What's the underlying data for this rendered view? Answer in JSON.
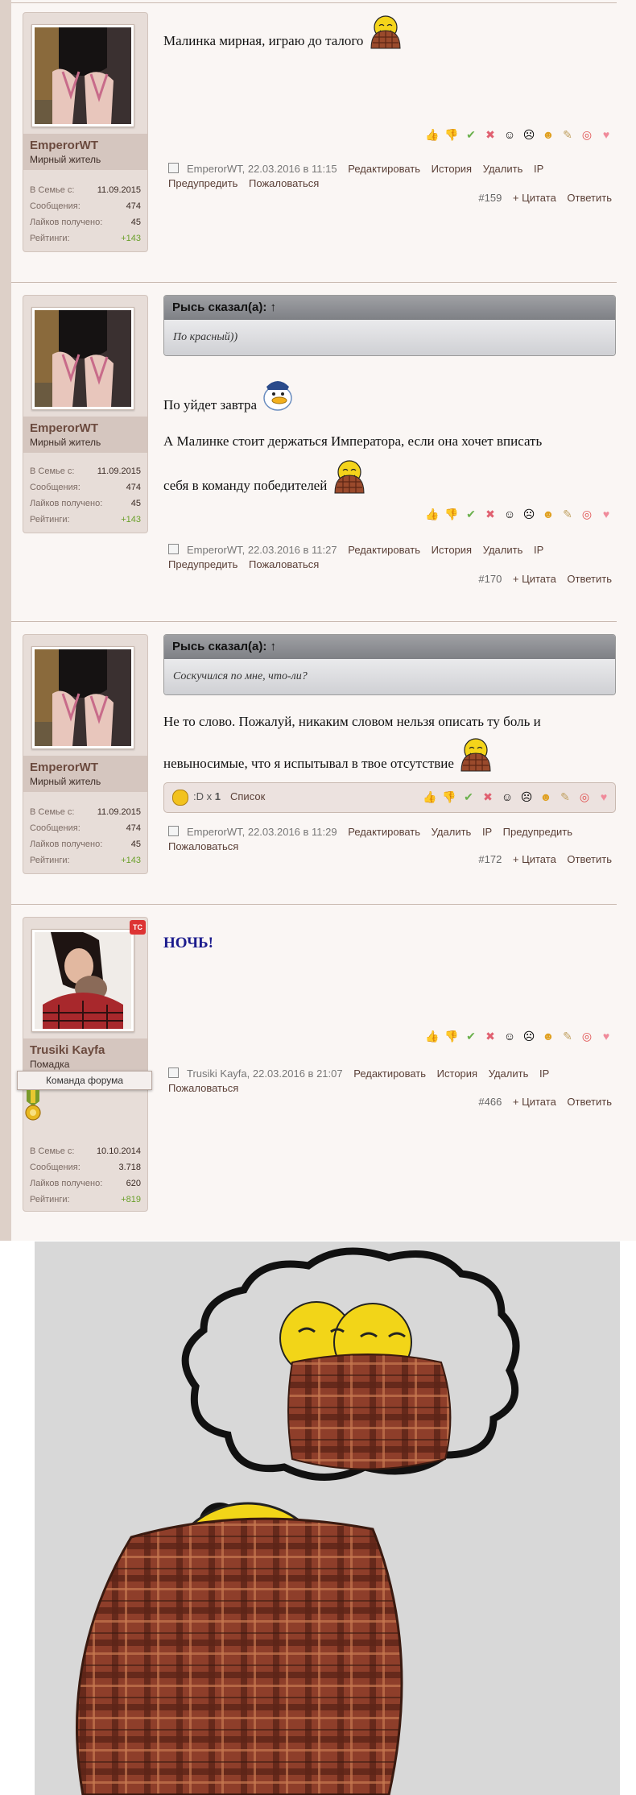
{
  "posts": [
    {
      "username": "EmperorWT",
      "user_title": "Мирный житель",
      "stats": {
        "joined_label": "В Семье с:",
        "joined": "11.09.2015",
        "messages_label": "Сообщения:",
        "messages": "474",
        "likes_label": "Лайков получено:",
        "likes": "45",
        "rating_label": "Рейтинги:",
        "rating": "+143"
      },
      "text": "Малинка мирная, играю до талого",
      "author_date": "EmperorWT, 22.03.2016 в 11:15",
      "actions": [
        "Редактировать",
        "История",
        "Удалить",
        "IP"
      ],
      "actions2": [
        "Предупредить",
        "Пожаловаться"
      ],
      "number": "#159",
      "quote_label": "+ Цитата",
      "reply_label": "Ответить"
    },
    {
      "username": "EmperorWT",
      "user_title": "Мирный житель",
      "stats": {
        "joined_label": "В Семье с:",
        "joined": "11.09.2015",
        "messages_label": "Сообщения:",
        "messages": "474",
        "likes_label": "Лайков получено:",
        "likes": "45",
        "rating_label": "Рейтинги:",
        "rating": "+143"
      },
      "quote_author": "Рысь сказал(а): ↑",
      "quote_text": "По красный))",
      "text1": "По уйдет завтра",
      "text2": "А Малинке стоит держаться Императора, если она хочет вписать",
      "text3": "себя в команду победителей",
      "author_date": "EmperorWT, 22.03.2016 в 11:27",
      "actions": [
        "Редактировать",
        "История",
        "Удалить",
        "IP"
      ],
      "actions2": [
        "Предупредить",
        "Пожаловаться"
      ],
      "number": "#170",
      "quote_label": "+ Цитата",
      "reply_label": "Ответить"
    },
    {
      "username": "EmperorWT",
      "user_title": "Мирный житель",
      "stats": {
        "joined_label": "В Семье с:",
        "joined": "11.09.2015",
        "messages_label": "Сообщения:",
        "messages": "474",
        "likes_label": "Лайков получено:",
        "likes": "45",
        "rating_label": "Рейтинги:",
        "rating": "+143"
      },
      "quote_author": "Рысь сказал(а): ↑",
      "quote_text": "Соскучился по мне, что-ли?",
      "text1": "Не то слово. Пожалуй, никаким словом нельзя описать ту боль и",
      "text2": "невыносимые, что я испытывал в твое отсутствие",
      "rating_summary": ":D x",
      "rating_count": "1",
      "rating_list": "Список",
      "author_date": "EmperorWT, 22.03.2016 в 11:29",
      "actions": [
        "Редактировать",
        "Удалить",
        "IP",
        "Предупредить"
      ],
      "actions2": [
        "Пожаловаться"
      ],
      "number": "#172",
      "quote_label": "+ Цитата",
      "reply_label": "Ответить"
    },
    {
      "username": "Trusiki Kayfa",
      "user_title": "Помадка",
      "team_label": "Команда форума",
      "tc_badge": "TC",
      "stats": {
        "joined_label": "В Семье с:",
        "joined": "10.10.2014",
        "messages_label": "Сообщения:",
        "messages": "3.718",
        "likes_label": "Лайков получено:",
        "likes": "620",
        "rating_label": "Рейтинги:",
        "rating": "+819"
      },
      "text": "НОЧЬ!",
      "author_date": "Trusiki Kayfa, 22.03.2016 в 21:07",
      "actions": [
        "Редактировать",
        "История",
        "Удалить",
        "IP"
      ],
      "actions2": [
        "Пожаловаться"
      ],
      "number": "#466",
      "quote_label": "+ Цитата",
      "reply_label": "Ответить"
    }
  ],
  "reaction_icons": [
    "thumbs-up-icon",
    "thumbs-down-icon",
    "check-icon",
    "cross-icon",
    "troll-face-icon",
    "facepalm-icon",
    "smile-icon",
    "pen-icon",
    "target-icon",
    "heart-icon"
  ],
  "colors": {
    "accent": "#6b4a3e",
    "rating_green": "#6aa02a",
    "night_blue": "#1a1a8c"
  }
}
